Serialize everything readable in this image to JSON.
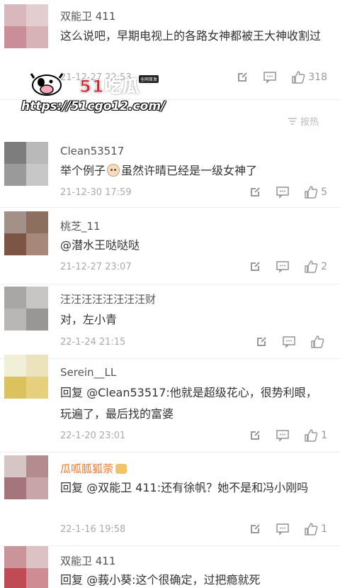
{
  "sort_label": "按热",
  "watermark": {
    "brand": "51吃瓜",
    "tag": "全网首发",
    "url": "https://51cgo12.com/"
  },
  "comments": [
    {
      "user": "双能卫 411",
      "text": "这么说吧，早期电视上的各路女神都被王大神收割过",
      "time": "21-12-27 22:53",
      "likes": "318",
      "avatar_colors": [
        "#d8b8bd",
        "#e2ced0",
        "#c98e97",
        "#d7b2b6"
      ]
    },
    {
      "user": "Clean53517",
      "text_before": "举个例子",
      "text_after": "虽然许晴已经是一级女神了",
      "time": "21-12-30 17:59",
      "likes": "5",
      "avatar_colors": [
        "#7d7d7d",
        "#b9b9b9",
        "#9a9a9a",
        "#c7c7c7"
      ]
    },
    {
      "user": "桃芝_11",
      "text": "@潜水王哒哒哒",
      "time": "21-12-27 23:07",
      "likes": "2",
      "avatar_colors": [
        "#a39088",
        "#8c6f5f",
        "#7c5544",
        "#a7877a"
      ]
    },
    {
      "user": "汪汪汪汪汪汪汪汪财",
      "text": "对，左小青",
      "time": "22-1-24 21:15",
      "likes": "",
      "avatar_colors": [
        "#a9a6a6",
        "#c8c5c5",
        "#b9b6b6",
        "#999696"
      ]
    },
    {
      "user": "Serein__LL",
      "text": "回复 @Clean53517:他就是超级花心，很势利眼，玩遍了，最后找的富婆",
      "time": "22-1-20 23:01",
      "likes": "1",
      "avatar_colors": [
        "#f2efd8",
        "#ece2bc",
        "#dcc25e",
        "#e6cf7d"
      ]
    },
    {
      "user": "瓜呱胍狐萗",
      "text": "回复 @双能卫 411:还有徐帆？她不是和冯小刚吗",
      "time": "22-1-16 19:58",
      "likes": "1",
      "avatar_colors": [
        "#d5c5c5",
        "#b48b8f",
        "#a37479",
        "#c8a5a8"
      ]
    },
    {
      "user": "双能卫 411",
      "text": "回复 @莪小葵:这个很确定，过把瘾就死",
      "time": "",
      "likes": "",
      "avatar_colors": [
        "#c9959a",
        "#ddc2c4",
        "#c04b55",
        "#cf8c92"
      ]
    }
  ]
}
